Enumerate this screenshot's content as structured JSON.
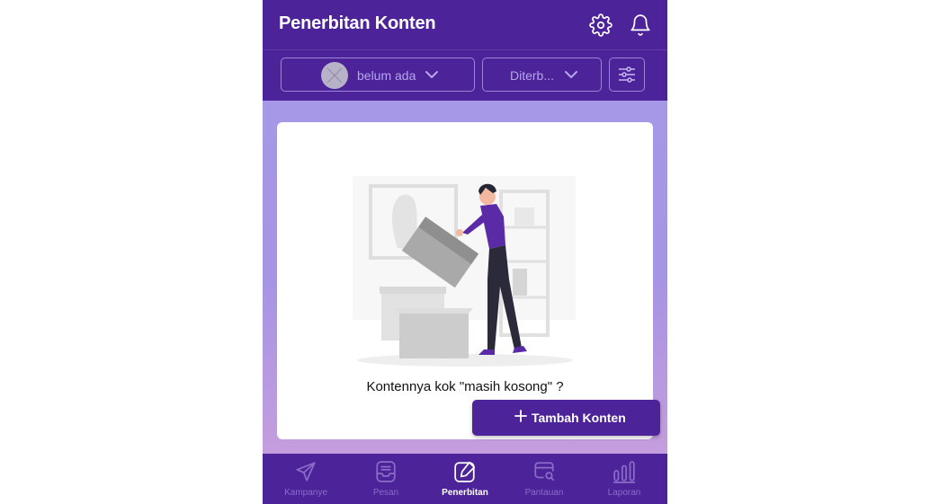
{
  "header": {
    "title": "Penerbitan Konten",
    "icons": [
      "gear-icon",
      "bell-icon"
    ]
  },
  "filters": {
    "account_label": "belum ada",
    "status_label": "Diterb...",
    "settings_icon": "sliders-icon"
  },
  "content": {
    "empty_message": "Kontennya kok \"masih kosong\" ?",
    "add_button_label": "Tambah Konten"
  },
  "bottom_nav": {
    "items": [
      {
        "label": "Kampanye",
        "icon": "send-icon"
      },
      {
        "label": "Pesan",
        "icon": "inbox-icon"
      },
      {
        "label": "Penerbitan",
        "icon": "edit-icon",
        "active": true
      },
      {
        "label": "Pantauan",
        "icon": "monitor-search-icon"
      },
      {
        "label": "Laporan",
        "icon": "bar-chart-icon"
      }
    ]
  },
  "colors": {
    "primary": "#4c2399",
    "accent_purple": "#5a2aa7",
    "muted_nav": "#8a6cc9",
    "background_gradient_top": "#a79be8",
    "background_gradient_bottom": "#cda0dc"
  }
}
